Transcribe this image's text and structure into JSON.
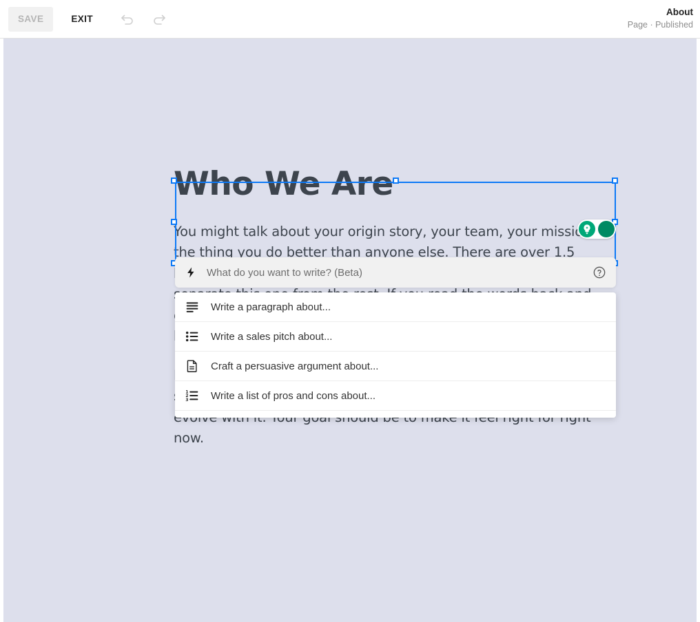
{
  "toolbar": {
    "save_label": "SAVE",
    "exit_label": "EXIT",
    "undo_icon": "undo-arrow-icon",
    "redo_icon": "redo-arrow-icon",
    "page_title": "About",
    "page_status": "Page · Published"
  },
  "page": {
    "heading": "Who We Are",
    "paragraph_1": "You might talk about your origin story, your team, your mission, or the thing you do better than anyone else. There are over 1.5 billion websites out there, but your story is what's going to separate this one from the rest. If you read the words back and don't hear your own voice in your head, that's a good sign you still have more work to do.",
    "paragraph_2": "Be clear, be confident, and don't overthink it. The beauty of your story is that it's going to continue to evolve and your site can evolve with it. Your goal should be to make it feel right for right now."
  },
  "ai_pill": {
    "light_icon": "lightbulb-icon",
    "dark_icon": "crescent-moon-icon",
    "light_color": "#00a878",
    "dark_color": "#008a63"
  },
  "prompt": {
    "bolt_icon": "lightning-bolt-icon",
    "placeholder": "What do you want to write? (Beta)",
    "value": "",
    "help_icon": "help-circle-icon"
  },
  "suggestions": {
    "items": [
      {
        "label": "Write a paragraph about...",
        "icon": "paragraph-lines-icon"
      },
      {
        "label": "Write a sales pitch about...",
        "icon": "bulleted-list-icon"
      },
      {
        "label": "Craft a persuasive argument about...",
        "icon": "document-icon"
      },
      {
        "label": "Write a list of pros and cons about...",
        "icon": "numbered-list-icon"
      }
    ]
  },
  "colors": {
    "canvas_bg": "#dddfec",
    "selection": "#0b79f7",
    "text": "#3d444d"
  }
}
